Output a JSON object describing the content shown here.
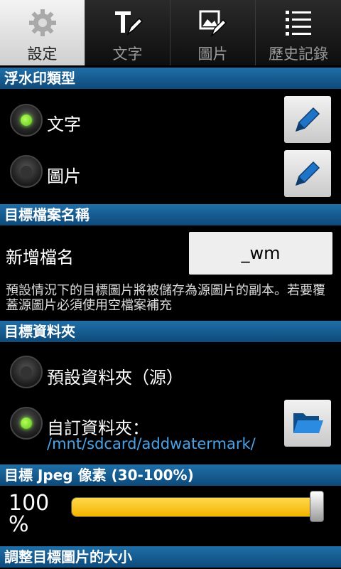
{
  "tabs": [
    {
      "label": "設定",
      "icon": "gear-icon"
    },
    {
      "label": "文字",
      "icon": "text-pen-icon"
    },
    {
      "label": "圖片",
      "icon": "image-pen-icon"
    },
    {
      "label": "歷史記錄",
      "icon": "list-icon"
    }
  ],
  "watermark_type": {
    "header": "浮水印類型",
    "options": [
      {
        "label": "文字",
        "selected": true,
        "action_icon": "pencil-icon"
      },
      {
        "label": "圖片",
        "selected": false,
        "action_icon": "pencil-icon"
      }
    ]
  },
  "target_filename": {
    "header": "目標檔案名稱",
    "label": "新增檔名",
    "value": "_wm",
    "description": "預設情況下的目標圖片將被儲存為源圖片的副本。若要覆蓋源圖片必須使用空檔案補充"
  },
  "target_folder": {
    "header": "目標資料夾",
    "default_label": "預設資料夾（源）",
    "custom_label": "自訂資料夾：",
    "custom_path": "/mnt/sdcard/addwatermark/",
    "default_selected": false,
    "custom_selected": true,
    "folder_icon": "folder-icon"
  },
  "jpeg_quality": {
    "header": "目標 Jpeg 像素 (30-100%)",
    "value_text": "100\n%",
    "value": 100,
    "min": 30,
    "max": 100
  },
  "resize": {
    "header": "調整目標圖片的大小"
  },
  "colors": {
    "accent": "#1f6fa8",
    "slider": "#f2b400",
    "radio_on": "#7cff2a",
    "link": "#4aa3e8"
  }
}
